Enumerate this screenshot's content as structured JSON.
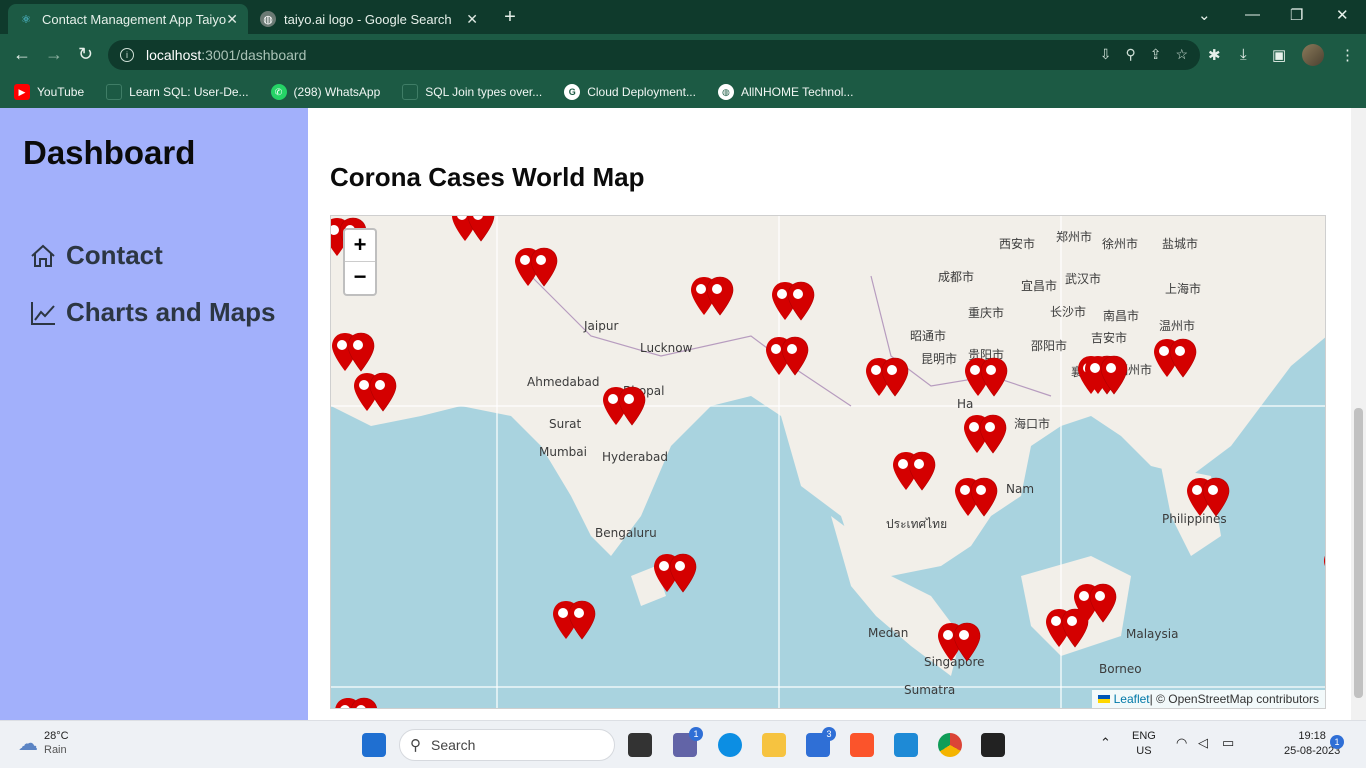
{
  "browser": {
    "tabs": [
      {
        "title": "Contact Management App Taiyo",
        "icon": "react-icon",
        "active": true
      },
      {
        "title": "taiyo.ai logo - Google Search",
        "icon": "globe-icon",
        "active": false
      }
    ],
    "url_host": "localhost",
    "url_path": ":3001/dashboard",
    "bookmarks": [
      {
        "label": "YouTube",
        "icon": "youtube-icon",
        "color": "#ff0000"
      },
      {
        "label": "Learn SQL: User-De...",
        "icon": "page-icon",
        "color": "#2b6b55"
      },
      {
        "label": "(298) WhatsApp",
        "icon": "whatsapp-icon",
        "color": "#25d366"
      },
      {
        "label": "SQL Join types over...",
        "icon": "page-icon",
        "color": "#2b6b55"
      },
      {
        "label": "Cloud Deployment...",
        "icon": "google-icon",
        "color": "#ffffff"
      },
      {
        "label": "AllNHOME Technol...",
        "icon": "globe-icon",
        "color": "#ffffff"
      }
    ]
  },
  "sidebar": {
    "title": "Dashboard",
    "items": [
      {
        "label": "Contact",
        "icon": "home-icon"
      },
      {
        "label": "Charts and Maps",
        "icon": "chart-line-icon"
      }
    ]
  },
  "main": {
    "map_title": "Corona Cases World Map",
    "zoom_in": "+",
    "zoom_out": "−",
    "attribution_leaflet": "Leaflet",
    "attribution_rest": " | © OpenStreetMap contributors",
    "labels": [
      "Jaipur",
      "Lucknow",
      "Ahmedabad",
      "Bhopal",
      "Surat",
      "Mumbai",
      "Hyderabad",
      "Bengaluru",
      "Medan",
      "Singapore",
      "Sumatra",
      "Borneo",
      "Malaysia",
      "Philippines",
      "Nam",
      "昆明市",
      "贵阳市",
      "成都市",
      "重庆市",
      "西安市",
      "郑州市",
      "徐州市",
      "盐城市",
      "武汉市",
      "长沙市",
      "南昌市",
      "上海市",
      "温州市",
      "吉安市",
      "邵阳市",
      "昭通市",
      "海口市",
      "宜昌市",
      "襄阳市",
      "福州市",
      "Ha",
      "ประเทศไทย"
    ],
    "marker_color": "#d40000"
  },
  "taskbar": {
    "temp": "28°C",
    "weather": "Rain",
    "search_placeholder": "Search",
    "lang_top": "ENG",
    "lang_bottom": "US",
    "time": "19:18",
    "date": "25-08-2023",
    "notif_count": "1",
    "teams_badge": "1",
    "mail_badge": "3"
  }
}
